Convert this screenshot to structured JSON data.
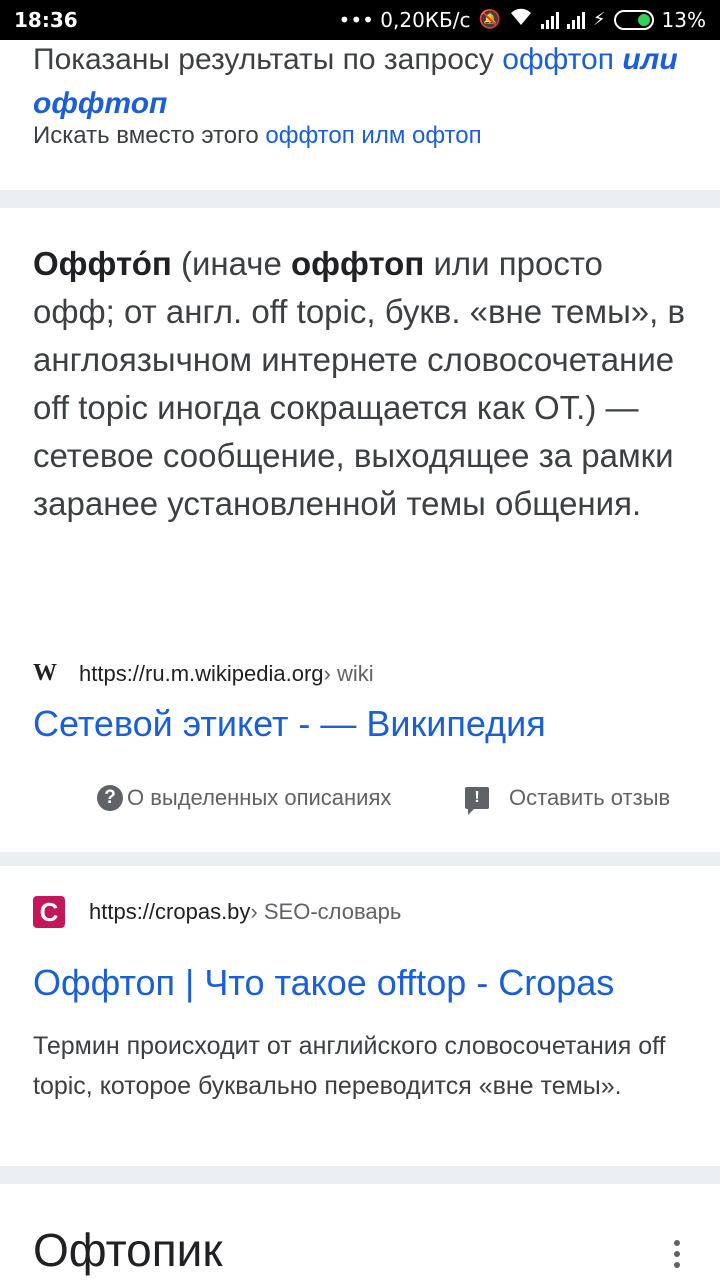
{
  "status_bar": {
    "time": "18:36",
    "speed": "••• 0,20КБ/с",
    "battery": "13%",
    "icons": [
      "mute-icon",
      "wifi-icon",
      "signal-icon",
      "signal-icon",
      "charging-icon",
      "battery-icon"
    ]
  },
  "query_notice": {
    "prefix": "Показаны результаты по запросу ",
    "corrected_part1": "оффтоп",
    "corrected_part2": "или оффтоп",
    "instead_prefix": "Искать вместо этого ",
    "instead_link": "оффтоп илм офтоп"
  },
  "featured": {
    "term": "Оффто́п",
    "text1": " (иначе ",
    "term2": "оффтоп",
    "text2": " или просто офф; от англ. off topic, букв. «вне темы», в англоязычном интернете словосочетание off topic иногда сокращается как ОТ.) — сетевое сообщение, выходящее за рамки заранее установленной темы общения.",
    "source_logo": "W",
    "source_url": "https://ru.m.wikipedia.org",
    "source_path": " › wiki",
    "title": "Сетевой этикет - — Википедия",
    "about_label": "О выделенных описаниях",
    "feedback_label": "Оставить отзыв"
  },
  "result2": {
    "logo": "C",
    "url": "https://cropas.by",
    "path": " › SEO-словарь",
    "title": "Оффтоп | Что такое offtop - Cropas",
    "snippet": "Термин происходит от английского словосочетания off topic, которое буквально переводится «вне темы»."
  },
  "knowledge_panel": {
    "heading": "Офтопик"
  },
  "colors": {
    "link": "#1a5fd6",
    "separator": "#eceff1",
    "cropas_logo": "#c2185b"
  }
}
